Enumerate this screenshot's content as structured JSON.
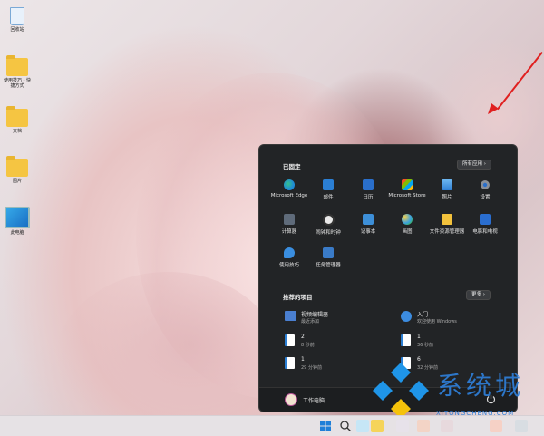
{
  "desktop": {
    "icons": [
      {
        "label": "回收站",
        "icon": "recycle-bin-icon"
      },
      {
        "label": "使用技巧 - 快捷方式",
        "icon": "folder-icon"
      },
      {
        "label": "文档",
        "icon": "folder-icon"
      },
      {
        "label": "图片",
        "icon": "folder-icon"
      },
      {
        "label": "此电脑",
        "icon": "monitor-icon"
      }
    ]
  },
  "start_menu": {
    "pinned_title": "已固定",
    "all_apps_label": "所有应用  ›",
    "pinned_apps": [
      {
        "label": "Microsoft Edge",
        "icon": "edge-icon",
        "color": "#1e8ad6"
      },
      {
        "label": "邮件",
        "icon": "mail-icon",
        "color": "#2b7fd4"
      },
      {
        "label": "日历",
        "icon": "calendar-icon",
        "color": "#2a6fcb"
      },
      {
        "label": "Microsoft Store",
        "icon": "store-icon",
        "color": "#3a7bd5"
      },
      {
        "label": "照片",
        "icon": "photos-icon",
        "color": "#4a9fe0"
      },
      {
        "label": "设置",
        "icon": "gear-icon",
        "color": "#8a8f98"
      },
      {
        "label": "计算器",
        "icon": "calculator-icon",
        "color": "#5f6b7a"
      },
      {
        "label": "闹钟和时钟",
        "icon": "clock-icon",
        "color": "#e9e9e9"
      },
      {
        "label": "记事本",
        "icon": "notepad-icon",
        "color": "#3d8fd8"
      },
      {
        "label": "画图",
        "icon": "paint-icon",
        "color": "#39a0e0"
      },
      {
        "label": "文件资源管理器",
        "icon": "file-explorer-icon",
        "color": "#f3c23c"
      },
      {
        "label": "电影和电视",
        "icon": "movies-icon",
        "color": "#2a6ed0"
      },
      {
        "label": "使用技巧",
        "icon": "tips-icon",
        "color": "#3a8ee0"
      },
      {
        "label": "任务管理器",
        "icon": "task-manager-icon",
        "color": "#3a7bc8"
      }
    ],
    "recommended_title": "推荐的项目",
    "more_label": "更多  ›",
    "recommended": [
      {
        "name": "视频编辑器",
        "time": "最近添加",
        "icon": "video-editor-icon",
        "color": "#4a7fd0"
      },
      {
        "name": "入门",
        "time": "欢迎使用 Windows",
        "icon": "get-started-icon",
        "color": "#3c8ce0"
      },
      {
        "name": "2",
        "time": "8 秒前",
        "icon": "file-icon",
        "color": "#ffffff"
      },
      {
        "name": "1",
        "time": "36 秒前",
        "icon": "file-icon",
        "color": "#ffffff"
      },
      {
        "name": "1",
        "time": "29 分钟前",
        "icon": "file-icon",
        "color": "#ffffff"
      },
      {
        "name": "6",
        "time": "32 分钟前",
        "icon": "file-icon",
        "color": "#ffffff"
      }
    ],
    "user_name": "工作电脑"
  },
  "watermark": {
    "text": "系统城",
    "url": "XITONGCHENG.COM"
  }
}
